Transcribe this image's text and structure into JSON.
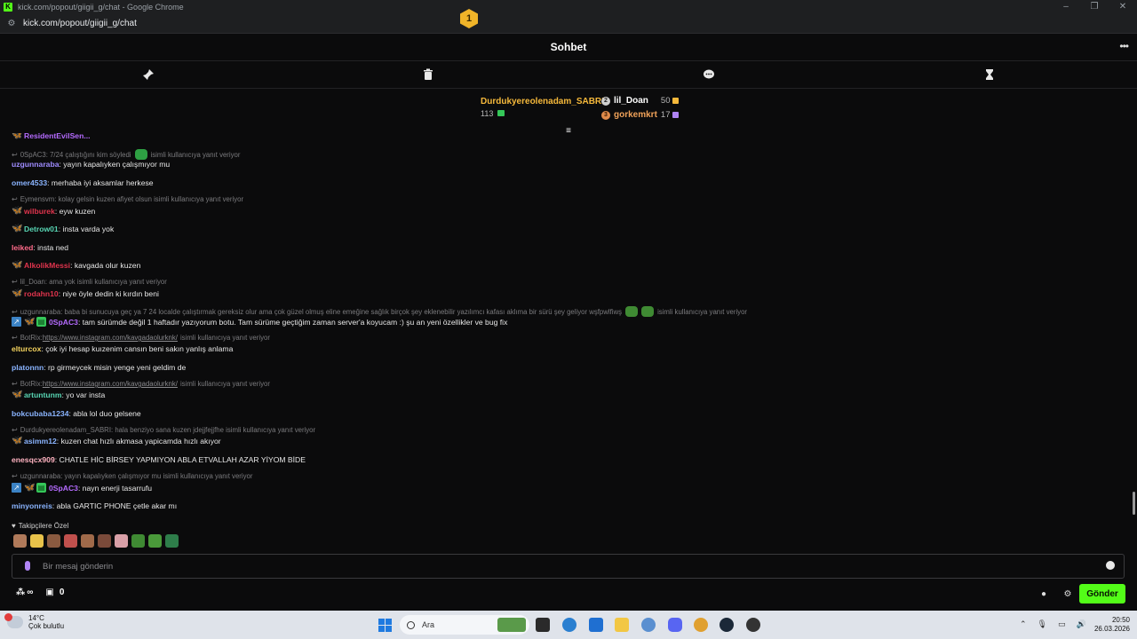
{
  "window": {
    "title": "kick.com/popout/giigii_g/chat - Google Chrome",
    "url": "kick.com/popout/giigii_g/chat"
  },
  "header": {
    "title": "Sohbet"
  },
  "toolbar": {
    "icons": [
      "pin-icon",
      "trash-icon",
      "chat-bubble-icon",
      "hourglass-icon"
    ]
  },
  "leaderboard": {
    "first": {
      "rank": "1",
      "name": "Durdukyereolenadam_SABRI",
      "count": "113"
    },
    "second": {
      "name": "lil_Doan",
      "count": "50"
    },
    "third": {
      "name": "gorkemkrt",
      "count": "17"
    }
  },
  "messages": [
    {
      "type": "reply",
      "text": "0SpAC3: 7/24 çalıştığını kim söyledi",
      "suffix": "isimli kullanıcıya yanıt veriyor"
    },
    {
      "type": "msg",
      "user": "uzgunnaraba",
      "color": "#9f8cff",
      "text": ": yayın kapalıyken çalışmıyor mu"
    },
    {
      "type": "msg",
      "user": "omer4533",
      "color": "#8ab4ff",
      "text": ": merhaba iyi aksamlar herkese"
    },
    {
      "type": "reply",
      "text": "Eymensvm: kolay gelsin kuzen afiyet olsun isimli kullanıcıya yanıt veriyor",
      "suffix": ""
    },
    {
      "type": "msg",
      "user": "wilburek",
      "color": "#e0344d",
      "text": ": eyw kuzen"
    },
    {
      "type": "msg",
      "user": "Detrow01",
      "color": "#58d6b4",
      "text": ": insta varda yok"
    },
    {
      "type": "msg",
      "user": "leiked",
      "color": "#ff6b8a",
      "text": ": insta ned"
    },
    {
      "type": "msg",
      "user": "AlkolikMessi",
      "color": "#e0344d",
      "text": ": kavgada olur kuzen"
    },
    {
      "type": "reply",
      "text": "lil_Doan: ama yok isimli kullanıcıya yanıt veriyor",
      "suffix": ""
    },
    {
      "type": "msg",
      "user": "rodahn10",
      "color": "#e0344d",
      "text": ": niye öyle dedin ki kırdın beni"
    },
    {
      "type": "reply",
      "text": "uzgunnaraba: baba bi sunucuya geç ya 7 24 localde çalıştırmak gereksiz olur ama çok güzel olmuş eline emeğine sağlık birçok şey eklenebilir yazılımcı kafası aklıma bir sürü şey geliyor wşfpwlfiwş",
      "suffix": "isimli kullanıcıya yanıt veriyor"
    },
    {
      "type": "msg",
      "user": "0SpAC3",
      "color": "#b56bff",
      "text": ": tam sürümde değil 1 haftadır yazıyorum botu. Tam sürüme geçtiğim zaman server'a koyucam :) şu an yeni özellikler ve bug fix"
    },
    {
      "type": "reply",
      "text": "BotRix: ",
      "link": "https://www.instagram.com/kavgadaolurknk/",
      "suffix": "isimli kullanıcıya yanıt veriyor"
    },
    {
      "type": "msg",
      "user": "elturcox",
      "color": "#f4d35e",
      "text": ": çok iyi hesap kuızenim cansın beni sakın yanlış anlama"
    },
    {
      "type": "msg",
      "user": "platonnn",
      "color": "#8ab4ff",
      "text": ": rp girmeycek misin yenge yeni geldim de"
    },
    {
      "type": "reply",
      "text": "BotRix: ",
      "link": "https://www.instagram.com/kavgadaolurknk/",
      "suffix": "isimli kullanıcıya yanıt veriyor"
    },
    {
      "type": "msg",
      "user": "artuntunm",
      "color": "#58d6b4",
      "text": ": yo var insta"
    },
    {
      "type": "msg",
      "user": "bokcubaba1234",
      "color": "#8ab4ff",
      "text": ": abla lol duo gelsene"
    },
    {
      "type": "reply",
      "text": "Durdukyereolenadam_SABRI: hala benziyo sana kuzen jdejjfejjfhe isimli kullanıcıya yanıt veriyor",
      "suffix": ""
    },
    {
      "type": "msg",
      "user": "asimm12",
      "color": "#8ab4ff",
      "text": ": kuzen chat hızlı akmasa yapicamda hızlı akıyor"
    },
    {
      "type": "msg",
      "user": "enesqcx909",
      "color": "#ffb3c1",
      "text": ": CHATLE HİC BİRSEY YAPMIYON ABLA ETVALLAH AZAR YİYOM BİDE"
    },
    {
      "type": "reply",
      "text": "uzgunnaraba: yayın kapalıyken çalışmıyor mu isimli kullanıcıya yanıt veriyor",
      "suffix": ""
    },
    {
      "type": "msg",
      "user": "0SpAC3",
      "color": "#b56bff",
      "text": ": nayn enerji tasarrufu"
    },
    {
      "type": "msg",
      "user": "minyonreis",
      "color": "#8ab4ff",
      "text": ": abla GARTIC PHONE çetle akar mı"
    }
  ],
  "partial_top": {
    "user": "ResidentEvilSen..."
  },
  "followers": {
    "label": "Takipçilere Özel"
  },
  "input": {
    "placeholder": "Bir mesaj gönderin"
  },
  "bottom": {
    "gift_count": "0",
    "send_label": "Gönder"
  },
  "taskbar": {
    "weather_temp": "14°C",
    "weather_text": "Çok bulutlu",
    "weather_badge": "1",
    "search_label": "Ara",
    "time": "20:50",
    "date": "26.03.2026"
  },
  "colors": {
    "accent": "#53fc18",
    "gold": "#f6b93b"
  }
}
